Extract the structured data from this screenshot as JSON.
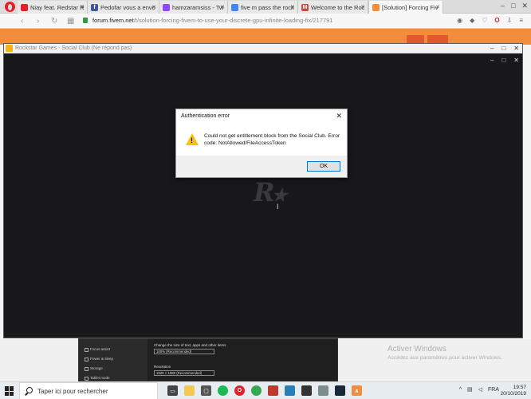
{
  "browser": {
    "tabs": [
      {
        "label": "Niay feat. Redstar Rad",
        "favicon_color": "#e5202a",
        "favicon_char": "",
        "active": false
      },
      {
        "label": "Pedofar vous a envoy",
        "favicon_color": "#3b5998",
        "favicon_char": "f",
        "active": false
      },
      {
        "label": "hamzaramsiss - Twitc",
        "favicon_color": "#9146ff",
        "favicon_char": "",
        "active": false
      },
      {
        "label": "five m pass the rocks",
        "favicon_color": "#4285f4",
        "favicon_char": "",
        "active": false
      },
      {
        "label": "Welcome to the Rock",
        "favicon_color": "#d44638",
        "favicon_char": "M",
        "active": false
      },
      {
        "label": "[Solution] Forcing Fiv",
        "favicon_color": "#f38c3b",
        "favicon_char": "",
        "active": true
      }
    ],
    "url_host": "forum.fivem.net",
    "url_path": "/t/solution-forcing-fivem-to-use-your-discrete-gpu-infinite-loading-fix/217791"
  },
  "sc_window": {
    "title": "Rockstar Games - Social Club (Ne répond pas)"
  },
  "dialog": {
    "title": "Authentication error",
    "message": "Could not get entitlement block from the Social Club. Error code: NotAllowed/FileAccessToken",
    "ok_label": "OK"
  },
  "settings_preview": {
    "sidebar_items": [
      "Focus assist",
      "Power & sleep",
      "Storage",
      "Tablet mode"
    ],
    "scale_label": "Change the size of text, apps and other items",
    "scale_value": "100% (Recommended)",
    "resolution_label": "Resolution",
    "resolution_value": "1920 × 1080 (Recommended)"
  },
  "watermark": {
    "title": "Activer Windows",
    "subtitle": "Accédez aux paramètres pour activer Windows."
  },
  "taskbar": {
    "search_placeholder": "Taper ici pour rechercher",
    "language": "FRA",
    "time": "19:57",
    "date": "20/10/2019"
  }
}
